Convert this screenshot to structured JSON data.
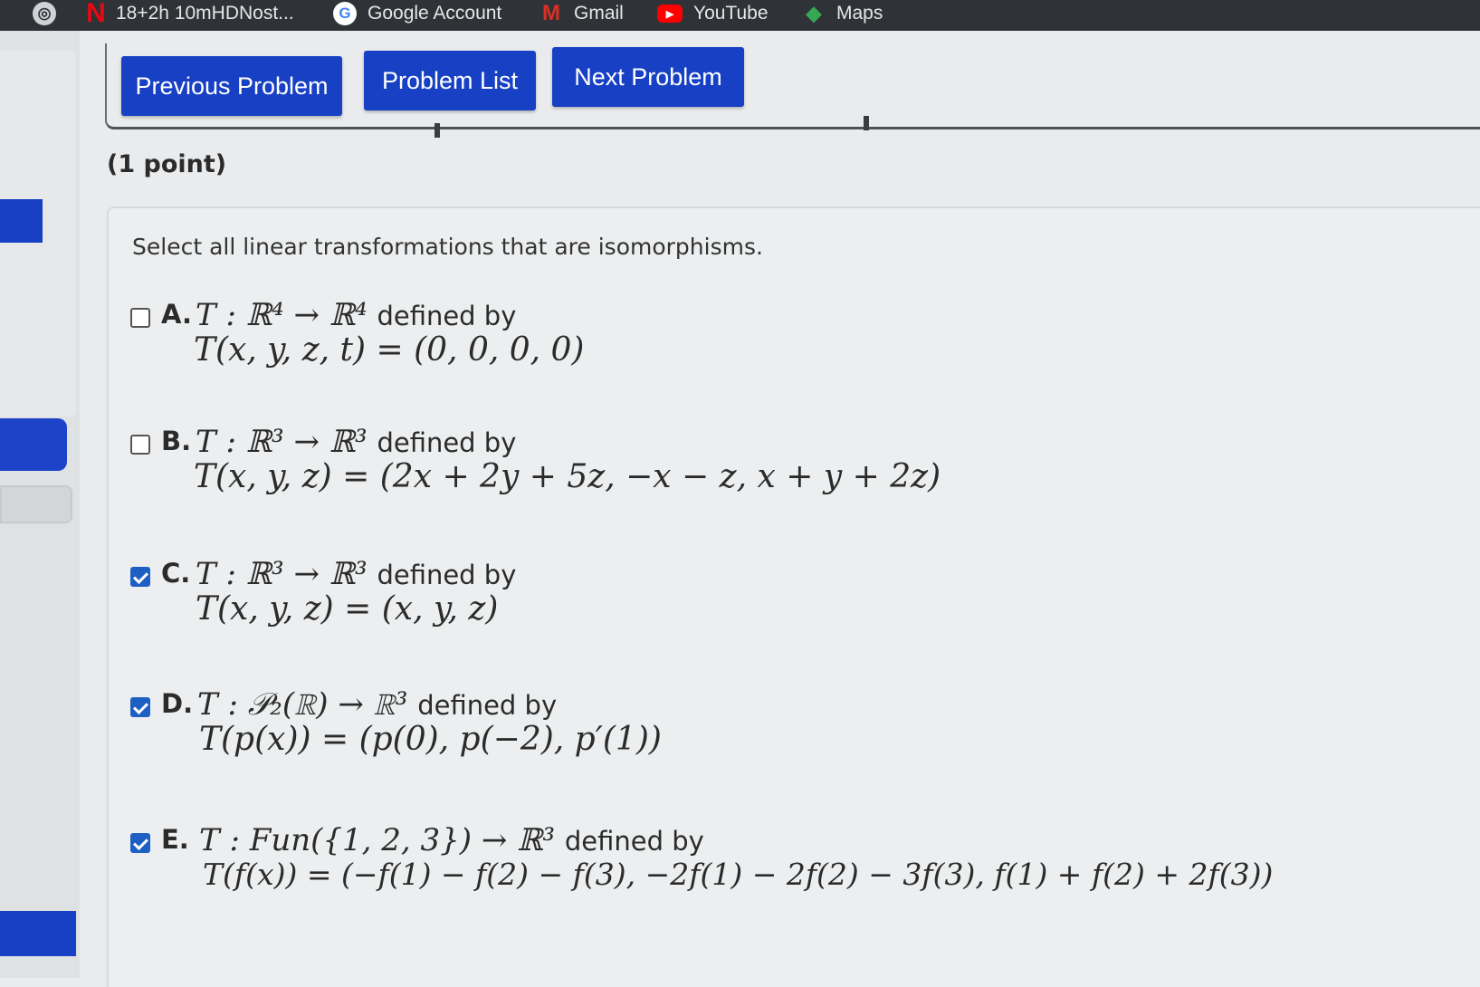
{
  "bookmarks": [
    {
      "icon": "globe-icon",
      "label": ""
    },
    {
      "icon": "netflix-icon",
      "label": "18+2h 10mHDNost..."
    },
    {
      "icon": "google-icon",
      "label": "Google Account"
    },
    {
      "icon": "gmail-icon",
      "label": "Gmail"
    },
    {
      "icon": "youtube-icon",
      "label": "YouTube"
    },
    {
      "icon": "maps-icon",
      "label": "Maps"
    }
  ],
  "nav": {
    "previous": "Previous Problem",
    "list": "Problem List",
    "next": "Next Problem"
  },
  "problem": {
    "points": "(1 point)",
    "prompt": "Select all linear transformations that are isomorphisms.",
    "choices": [
      {
        "letter": "A.",
        "checked": false,
        "header": "T : ℝ⁴ → ℝ⁴",
        "defined_by": "defined by",
        "formula": "T(x, y, z, t) = (0, 0, 0, 0)"
      },
      {
        "letter": "B.",
        "checked": false,
        "header": "T : ℝ³ → ℝ³",
        "defined_by": "defined by",
        "formula": "T(x, y, z) = (2x + 2y + 5z,  −x − z,  x + y + 2z)"
      },
      {
        "letter": "C.",
        "checked": true,
        "header": "T : ℝ³ → ℝ³",
        "defined_by": "defined by",
        "formula": "T(x, y, z) = (x, y, z)"
      },
      {
        "letter": "D.",
        "checked": true,
        "header": "T : 𝒫₂(ℝ) → ℝ³",
        "defined_by": "defined by",
        "formula": "T(p(x)) = (p(0),  p(−2),  p′(1))"
      },
      {
        "letter": "E.",
        "checked": true,
        "header": "T : Fun({1, 2, 3}) → ℝ³",
        "defined_by": "defined by",
        "formula": "T(f(x)) = (−f(1) − f(2) − f(3),  −2f(1) − 2f(2) − 3f(3),  f(1) + f(2) + 2f(3))"
      }
    ]
  }
}
